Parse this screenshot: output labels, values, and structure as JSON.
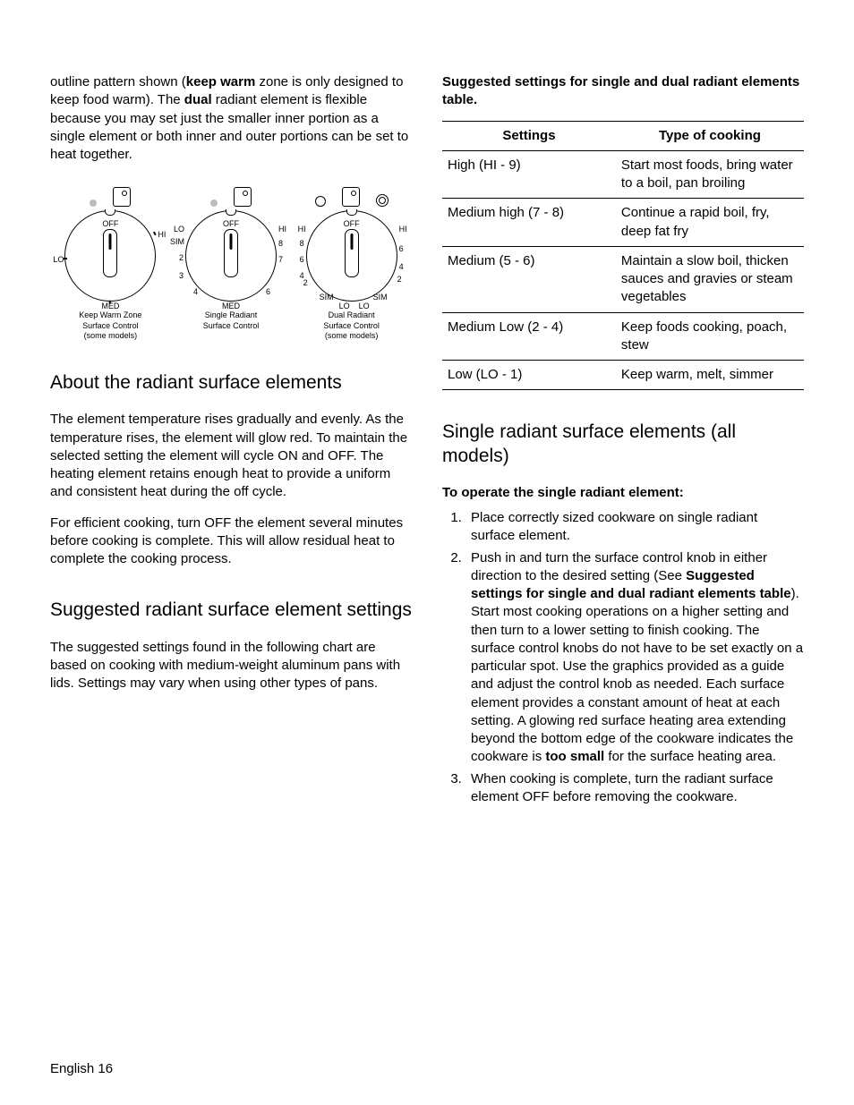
{
  "intro": {
    "pre": "outline pattern shown (",
    "kw": "keep warm",
    "mid": " zone is only designed to keep food warm). The ",
    "dual": "dual",
    "post": " radiant element is flexible because you may set just the smaller inner portion as a single element or both inner and outer portions can be set to heat together."
  },
  "dials": {
    "a": {
      "labels": {
        "off": "OFF",
        "hi": "HI",
        "lo": "LO",
        "med": "MED"
      },
      "caption_l1": "Keep Warm Zone",
      "caption_l2": "Surface Control",
      "caption_l3": "(some models)"
    },
    "b": {
      "labels": {
        "off": "OFF",
        "hi": "HI",
        "lo": "LO",
        "sim": "SIM",
        "med": "MED",
        "n2": "2",
        "n3": "3",
        "n4": "4",
        "n6": "6",
        "n7": "7",
        "n8": "8"
      },
      "caption_l1": "Single Radiant",
      "caption_l2": "Surface Control"
    },
    "c": {
      "labels": {
        "off": "OFF",
        "hiL": "HI",
        "hiR": "HI",
        "loL": "LO",
        "loR": "LO",
        "simL": "SIM",
        "simR": "SIM",
        "n2": "2",
        "n4": "4",
        "n6": "6",
        "n8": "8"
      },
      "caption_l1": "Dual Radiant",
      "caption_l2": "Surface Control",
      "caption_l3": "(some models)"
    }
  },
  "about": {
    "heading": "About the radiant surface elements",
    "p1": "The element temperature rises gradually and evenly. As the temperature rises, the element will glow red. To maintain the selected setting the element will cycle ON and OFF. The heating element retains enough heat to provide a uniform and consistent heat during the off cycle.",
    "p2": "For efficient cooking, turn OFF the element several minutes before cooking is complete. This will allow residual heat to complete the cooking process."
  },
  "suggested": {
    "heading": "Suggested radiant surface element settings",
    "p1": "The suggested settings found in the following chart are based on cooking with medium-weight aluminum pans with lids. Settings may vary when using other types of pans."
  },
  "table": {
    "title": "Suggested settings for single and dual radiant elements table.",
    "head_a": "Settings",
    "head_b": "Type of cooking",
    "rows": [
      {
        "a": "High (HI - 9)",
        "b": "Start most foods, bring water to a boil, pan broiling"
      },
      {
        "a": "Medium high (7 - 8)",
        "b": "Continue a rapid boil, fry, deep fat fry"
      },
      {
        "a": "Medium (5 - 6)",
        "b": "Maintain a slow boil, thicken sauces and gravies or steam vegetables"
      },
      {
        "a": "Medium Low (2 - 4)",
        "b": "Keep foods cooking, poach, stew"
      },
      {
        "a": "Low (LO - 1)",
        "b": "Keep warm, melt, simmer"
      }
    ]
  },
  "single": {
    "heading": "Single radiant surface elements (all models)",
    "sub": "To operate the single radiant element:",
    "li1": "Place correctly sized cookware on single radiant surface element.",
    "li2_a": "Push in and turn the surface control knob in either direction to the desired setting (See ",
    "li2_bold": "Suggested settings for single and dual radiant elements table",
    "li2_b": "). Start most cooking operations on a higher setting and then turn to a lower setting to finish cooking. The surface control knobs do not have to be set exactly on a particular spot. Use the graphics provided as a guide and adjust the control knob as needed. Each surface element provides a constant amount of heat at each setting. A glowing red surface heating area extending beyond the bottom edge of the cookware indicates the cookware is ",
    "li2_bold2": "too small",
    "li2_c": " for the surface heating area.",
    "li3": "When cooking is complete, turn the radiant surface element OFF before removing the cookware."
  },
  "footer": "English 16",
  "chart_data": {
    "type": "table",
    "title": "Suggested settings for single and dual radiant elements",
    "columns": [
      "Settings",
      "Type of cooking"
    ],
    "rows": [
      [
        "High (HI - 9)",
        "Start most foods, bring water to a boil, pan broiling"
      ],
      [
        "Medium high (7 - 8)",
        "Continue a rapid boil, fry, deep fat fry"
      ],
      [
        "Medium (5 - 6)",
        "Maintain a slow boil, thicken sauces and gravies or steam vegetables"
      ],
      [
        "Medium Low (2 - 4)",
        "Keep foods cooking, poach, stew"
      ],
      [
        "Low (LO - 1)",
        "Keep warm, melt, simmer"
      ]
    ]
  }
}
